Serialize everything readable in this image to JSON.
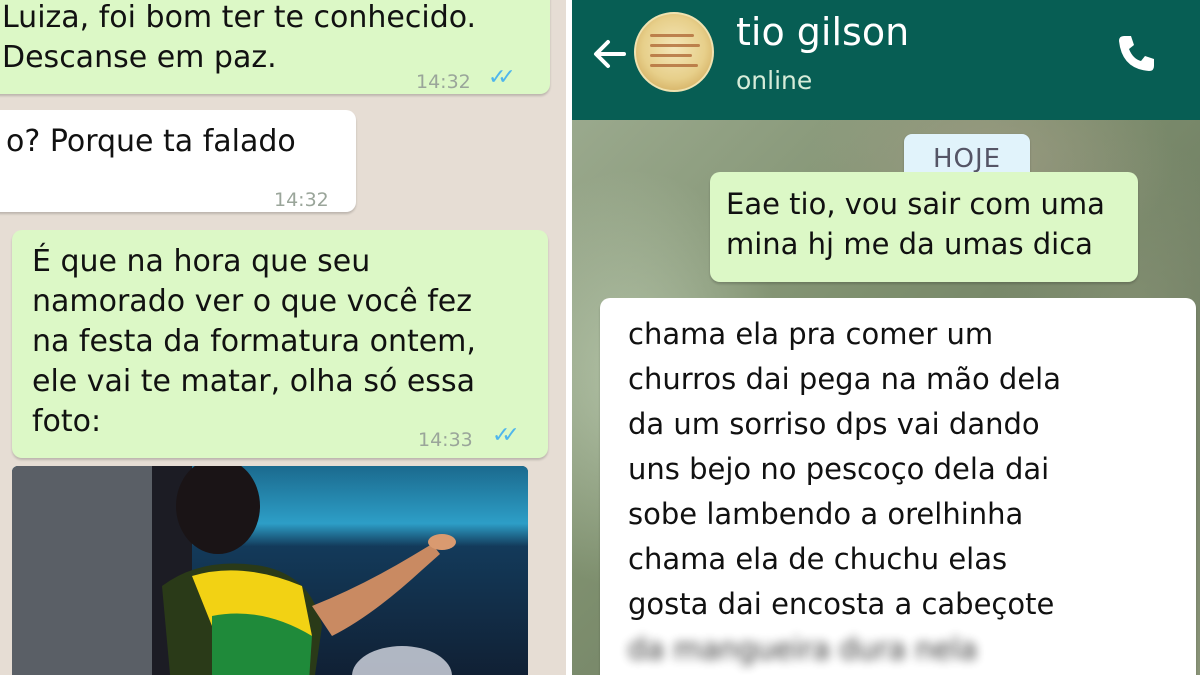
{
  "left_chat": {
    "messages": [
      {
        "text": "Luiza, foi bom ter te conhecido.\nDescanse em paz.",
        "time": "14:32",
        "ticks": "✓✓"
      },
      {
        "text": "o? Porque ta falado",
        "time": "14:32"
      },
      {
        "text": "É que na hora que seu\nnamorado ver o que você fez\nna festa da formatura ontem,\nele vai te matar, olha só essa\nfoto:",
        "time": "14:33",
        "ticks": "✓✓"
      }
    ]
  },
  "right_chat": {
    "header": {
      "contact_name": "tio gilson",
      "status": "online"
    },
    "date_label": "HOJE",
    "messages": [
      {
        "text": "Eae tio, vou sair com uma\nmina hj me da umas dica"
      },
      {
        "text": "chama ela pra comer um\nchurros dai pega na mão dela\nda um sorriso dps vai dando\nuns bejo no pescoço dela dai\nsobe lambendo a orelhinha\nchama ela de chuchu elas\ngosta dai encosta a cabeçote",
        "blurred_text": "da mangueira dura nela"
      }
    ]
  },
  "colors": {
    "header": "#075e54",
    "outgoing_bubble": "#dcf8c6",
    "incoming_bubble": "#ffffff",
    "read_ticks": "#4fb6ec",
    "left_background": "#e6ddd4"
  },
  "icons": [
    "back-arrow-icon",
    "phone-icon",
    "read-ticks-icon"
  ]
}
